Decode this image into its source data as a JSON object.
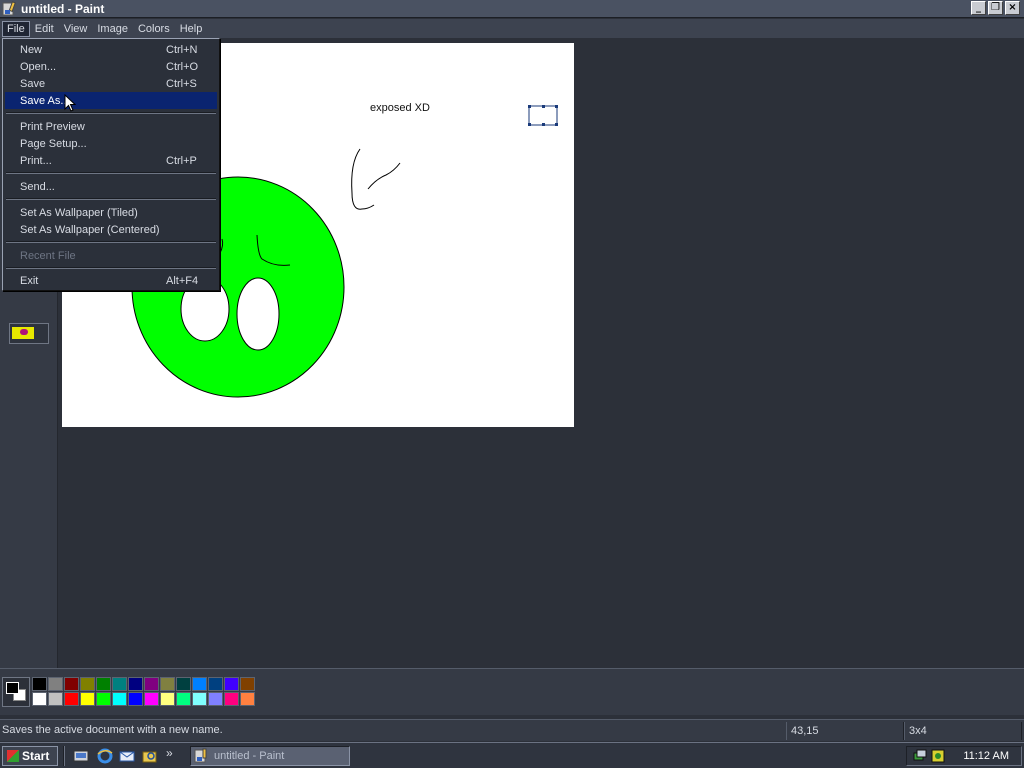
{
  "window": {
    "title": "untitled - Paint",
    "controls": [
      "minimize",
      "restore",
      "close"
    ]
  },
  "menubar": {
    "items": [
      "File",
      "Edit",
      "View",
      "Image",
      "Colors",
      "Help"
    ],
    "open_menu": "File"
  },
  "file_menu": {
    "items": [
      {
        "label": "New",
        "shortcut": "Ctrl+N"
      },
      {
        "label": "Open...",
        "shortcut": "Ctrl+O"
      },
      {
        "label": "Save",
        "shortcut": "Ctrl+S"
      },
      {
        "label": "Save As...",
        "shortcut": "",
        "selected": true
      },
      {
        "label": "Print Preview",
        "shortcut": ""
      },
      {
        "label": "Page Setup...",
        "shortcut": ""
      },
      {
        "label": "Print...",
        "shortcut": "Ctrl+P"
      },
      {
        "label": "Send...",
        "shortcut": ""
      },
      {
        "label": "Set As Wallpaper (Tiled)",
        "shortcut": ""
      },
      {
        "label": "Set As Wallpaper (Centered)",
        "shortcut": ""
      },
      {
        "label": "Recent File",
        "shortcut": "",
        "disabled": true
      },
      {
        "label": "Exit",
        "shortcut": "Alt+F4"
      }
    ]
  },
  "canvas": {
    "text": "exposed XD",
    "background": "#ffffff",
    "fill_color": "#00ff00"
  },
  "palette": {
    "foreground": "#000000",
    "background": "#ffffff",
    "colors": [
      "#000000",
      "#808080",
      "#800000",
      "#808000",
      "#008000",
      "#008080",
      "#000080",
      "#800080",
      "#808040",
      "#004040",
      "#0080ff",
      "#004080",
      "#4000ff",
      "#804000",
      "#ffffff",
      "#c0c0c0",
      "#ff0000",
      "#ffff00",
      "#00ff00",
      "#00ffff",
      "#0000ff",
      "#ff00ff",
      "#ffff80",
      "#00ff80",
      "#80ffff",
      "#8080ff",
      "#ff0080",
      "#ff8040"
    ]
  },
  "statusbar": {
    "message": "Saves the active document with a new name.",
    "coords": "43,15",
    "size": "3x4"
  },
  "taskbar": {
    "start_label": "Start",
    "quick_launch": [
      "show-desktop-icon",
      "internet-explorer-icon",
      "outlook-express-icon",
      "windows-explorer-icon"
    ],
    "more": "»",
    "task_label": "untitled - Paint",
    "clock": "11:12 AM"
  }
}
